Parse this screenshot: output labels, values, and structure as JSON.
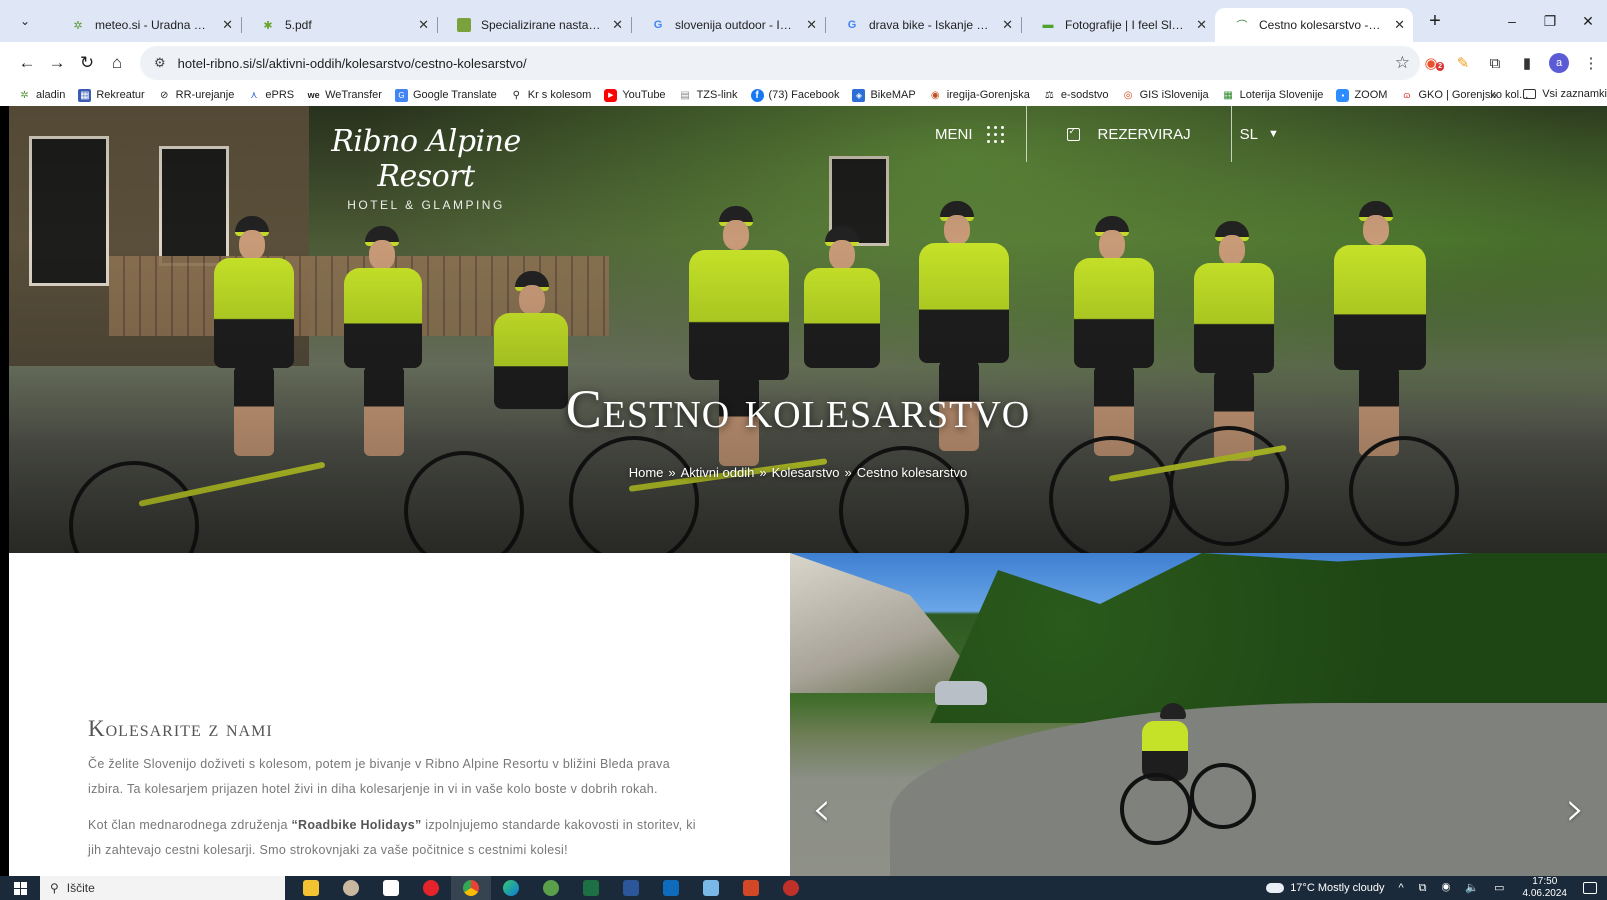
{
  "browser": {
    "tabs": [
      {
        "title": "meteo.si - Uradna vremenska n",
        "favicon": "meteo-icon",
        "active": false
      },
      {
        "title": "5.pdf",
        "favicon": "pdf-icon",
        "active": false
      },
      {
        "title": "Specializirane nastanitve za kol",
        "favicon": "page-icon",
        "active": false
      },
      {
        "title": "slovenija outdoor - Iskanje Goo",
        "favicon": "google-icon",
        "active": false
      },
      {
        "title": "drava bike - Iskanje Google",
        "favicon": "google-icon",
        "active": false
      },
      {
        "title": "Fotografije | I feel Slovenia",
        "favicon": "slovenia-icon",
        "active": false
      },
      {
        "title": "Cestno kolesarstvo - Ribno Alp",
        "favicon": "ribno-icon",
        "active": true
      }
    ],
    "url": "hotel-ribno.si/sl/aktivni-oddih/kolesarstvo/cestno-kolesarstvo/",
    "bookmarks": [
      {
        "label": "aladin",
        "icon": "aladin-icon"
      },
      {
        "label": "Rekreatur",
        "icon": "rekreatur-icon"
      },
      {
        "label": "RR-urejanje",
        "icon": "rr-icon"
      },
      {
        "label": "ePRS",
        "icon": "eprs-icon"
      },
      {
        "label": "WeTransfer",
        "icon": "wetransfer-icon"
      },
      {
        "label": "Google Translate",
        "icon": "translate-icon"
      },
      {
        "label": "Kr s kolesom",
        "icon": "bike-icon"
      },
      {
        "label": "YouTube",
        "icon": "youtube-icon"
      },
      {
        "label": "TZS-link",
        "icon": "doc-icon"
      },
      {
        "label": "(73) Facebook",
        "icon": "facebook-icon"
      },
      {
        "label": "BikeMAP",
        "icon": "bikemap-icon"
      },
      {
        "label": "iregija-Gorenjska",
        "icon": "iregija-icon"
      },
      {
        "label": "e-sodstvo",
        "icon": "scales-icon"
      },
      {
        "label": "GIS iSlovenija",
        "icon": "gis-icon"
      },
      {
        "label": "Loterija Slovenije",
        "icon": "loterija-icon"
      },
      {
        "label": "ZOOM",
        "icon": "zoom-icon"
      },
      {
        "label": "GKO | Gorenjsko kol...",
        "icon": "gko-icon"
      }
    ],
    "bookmarks_more": "»",
    "bookmarks_folder": "Vsi zaznamki",
    "extension_badge": "2",
    "profile_initial": "a"
  },
  "site": {
    "logo_main": "Ribno Alpine Resort",
    "logo_sub": "HOTEL & GLAMPING",
    "menu_label": "MENI",
    "book_label": "REZERVIRAJ",
    "lang_label": "SL",
    "hero_title": "Cestno kolesarstvo",
    "breadcrumb": [
      "Home",
      "Aktivni oddih",
      "Kolesarstvo",
      "Cestno kolesarstvo"
    ],
    "breadcrumb_sep": "»",
    "section_heading": "Kolesarite z nami",
    "paragraph1": "Če želite Slovenijo doživeti s kolesom, potem je bivanje v Ribno Alpine Resortu v bližini Bleda prava izbira. Ta kolesarjem prijazen hotel živi in diha kolesarjenje in vi in vaše kolo boste v dobrih rokah.",
    "paragraph2_before": "Kot član mednarodnega združenja ",
    "paragraph2_bold": "“Roadbike Holidays”",
    "paragraph2_after": " izpolnjujemo standarde kakovosti in storitev, ki jih zahtevajo cestni kolesarji. Smo strokovnjaki za vaše počitnice s cestnimi kolesi!",
    "slider_prev": "‹",
    "slider_next": "›"
  },
  "taskbar": {
    "search_placeholder": "Iščite",
    "weather": "17°C  Mostly cloudy",
    "time": "17:50",
    "date": "4.06.2024"
  }
}
